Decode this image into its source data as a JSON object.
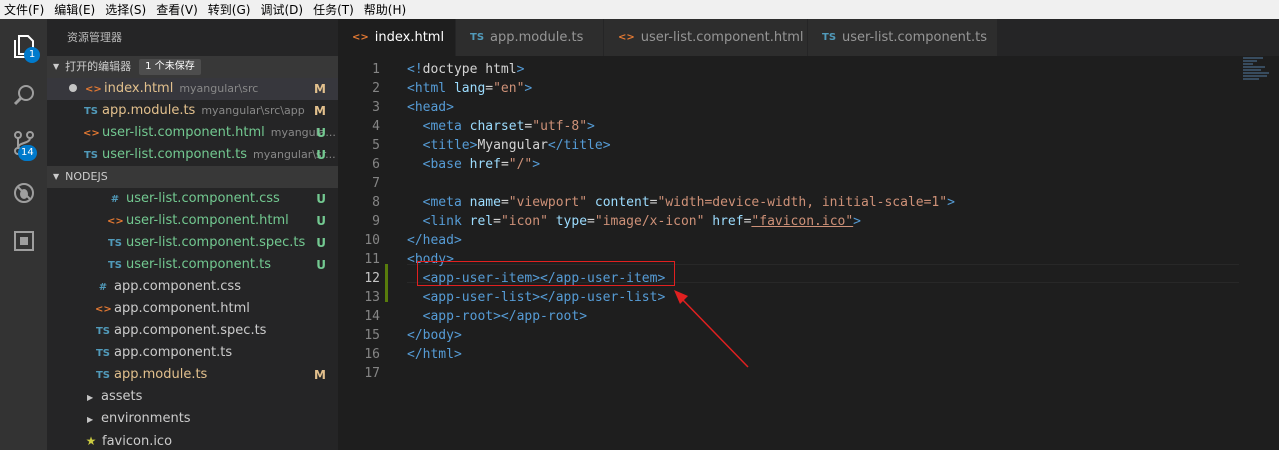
{
  "menu": [
    "文件(F)",
    "编辑(E)",
    "选择(S)",
    "查看(V)",
    "转到(G)",
    "调试(D)",
    "任务(T)",
    "帮助(H)"
  ],
  "activity": {
    "explorer_badge": "1",
    "scm_badge": "14"
  },
  "sidebar": {
    "title": "资源管理器",
    "open_editors": {
      "header": "打开的编辑器",
      "unsaved_badge": "1 个未保存",
      "items": [
        {
          "icon": "<>",
          "name": "index.html",
          "path": "myangular\\src",
          "status": "M"
        },
        {
          "icon": "TS",
          "name": "app.module.ts",
          "path": "myangular\\src\\app",
          "status": "M"
        },
        {
          "icon": "<>",
          "name": "user-list.component.html",
          "path": "myangula...",
          "status": "U"
        },
        {
          "icon": "TS",
          "name": "user-list.component.ts",
          "path": "myangular\\sr...",
          "status": "U"
        }
      ]
    },
    "workspace": {
      "header": "NODEJS",
      "items": [
        {
          "icon": "#",
          "name": "user-list.component.css",
          "status": "U"
        },
        {
          "icon": "<>",
          "name": "user-list.component.html",
          "status": "U"
        },
        {
          "icon": "TS",
          "name": "user-list.component.spec.ts",
          "status": "U"
        },
        {
          "icon": "TS",
          "name": "user-list.component.ts",
          "status": "U"
        },
        {
          "icon": "#",
          "name": "app.component.css",
          "status": ""
        },
        {
          "icon": "<>",
          "name": "app.component.html",
          "status": ""
        },
        {
          "icon": "TS",
          "name": "app.component.spec.ts",
          "status": ""
        },
        {
          "icon": "TS",
          "name": "app.component.ts",
          "status": ""
        },
        {
          "icon": "TS",
          "name": "app.module.ts",
          "status": "M"
        },
        {
          "icon": ">",
          "name": "assets",
          "status": ""
        },
        {
          "icon": ">",
          "name": "environments",
          "status": ""
        },
        {
          "icon": "★",
          "name": "favicon.ico",
          "status": ""
        }
      ]
    }
  },
  "tabs": [
    {
      "icon": "<>",
      "label": "index.html",
      "active": true,
      "dirty": true
    },
    {
      "icon": "TS",
      "label": "app.module.ts",
      "active": false
    },
    {
      "icon": "<>",
      "label": "user-list.component.html",
      "active": false
    },
    {
      "icon": "TS",
      "label": "user-list.component.ts",
      "active": false
    }
  ],
  "editor": {
    "lines": [
      {
        "n": "1",
        "tokens": [
          [
            "t-tag",
            "<!"
          ],
          [
            "t-txt",
            "doctype html"
          ],
          [
            "t-tag",
            ">"
          ]
        ]
      },
      {
        "n": "2",
        "tokens": [
          [
            "t-tag",
            "<html "
          ],
          [
            "t-attr",
            "lang"
          ],
          [
            "t-txt",
            "="
          ],
          [
            "t-str",
            "\"en\""
          ],
          [
            "t-tag",
            ">"
          ]
        ]
      },
      {
        "n": "3",
        "tokens": [
          [
            "t-tag",
            "<head>"
          ]
        ]
      },
      {
        "n": "4",
        "tokens": [
          [
            "t-txt",
            "  "
          ],
          [
            "t-tag",
            "<meta "
          ],
          [
            "t-attr",
            "charset"
          ],
          [
            "t-txt",
            "="
          ],
          [
            "t-str",
            "\"utf-8\""
          ],
          [
            "t-tag",
            ">"
          ]
        ]
      },
      {
        "n": "5",
        "tokens": [
          [
            "t-txt",
            "  "
          ],
          [
            "t-tag",
            "<title>"
          ],
          [
            "t-txt",
            "Myangular"
          ],
          [
            "t-tag",
            "</title>"
          ]
        ]
      },
      {
        "n": "6",
        "tokens": [
          [
            "t-txt",
            "  "
          ],
          [
            "t-tag",
            "<base "
          ],
          [
            "t-attr",
            "href"
          ],
          [
            "t-txt",
            "="
          ],
          [
            "t-str",
            "\"/\""
          ],
          [
            "t-tag",
            ">"
          ]
        ]
      },
      {
        "n": "7",
        "tokens": []
      },
      {
        "n": "8",
        "tokens": [
          [
            "t-txt",
            "  "
          ],
          [
            "t-tag",
            "<meta "
          ],
          [
            "t-attr",
            "name"
          ],
          [
            "t-txt",
            "="
          ],
          [
            "t-str",
            "\"viewport\""
          ],
          [
            "t-txt",
            " "
          ],
          [
            "t-attr",
            "content"
          ],
          [
            "t-txt",
            "="
          ],
          [
            "t-str",
            "\"width=device-width, initial-scale=1\""
          ],
          [
            "t-tag",
            ">"
          ]
        ]
      },
      {
        "n": "9",
        "tokens": [
          [
            "t-txt",
            "  "
          ],
          [
            "t-tag",
            "<link "
          ],
          [
            "t-attr",
            "rel"
          ],
          [
            "t-txt",
            "="
          ],
          [
            "t-str",
            "\"icon\""
          ],
          [
            "t-txt",
            " "
          ],
          [
            "t-attr",
            "type"
          ],
          [
            "t-txt",
            "="
          ],
          [
            "t-str",
            "\"image/x-icon\""
          ],
          [
            "t-txt",
            " "
          ],
          [
            "t-attr",
            "href"
          ],
          [
            "t-txt",
            "="
          ],
          [
            "t-str",
            "\"favicon.ico\""
          ],
          [
            "t-tag",
            ">"
          ]
        ]
      },
      {
        "n": "10",
        "tokens": [
          [
            "t-tag",
            "</head>"
          ]
        ]
      },
      {
        "n": "11",
        "tokens": [
          [
            "t-tag",
            "<body>"
          ]
        ]
      },
      {
        "n": "12",
        "tokens": [
          [
            "t-txt",
            "  "
          ],
          [
            "t-tag",
            "<app-user-item></app-user-item>"
          ]
        ]
      },
      {
        "n": "13",
        "tokens": [
          [
            "t-txt",
            "  "
          ],
          [
            "t-tag",
            "<app-user-list></app-user-list>"
          ]
        ]
      },
      {
        "n": "14",
        "tokens": [
          [
            "t-txt",
            "  "
          ],
          [
            "t-tag",
            "<app-root></app-root>"
          ]
        ]
      },
      {
        "n": "15",
        "tokens": [
          [
            "t-tag",
            "</body>"
          ]
        ]
      },
      {
        "n": "16",
        "tokens": [
          [
            "t-tag",
            "</html>"
          ]
        ]
      },
      {
        "n": "17",
        "tokens": []
      }
    ],
    "current_line": "12"
  },
  "colors": {
    "annotation": "#e02020",
    "accent": "#007acc"
  }
}
